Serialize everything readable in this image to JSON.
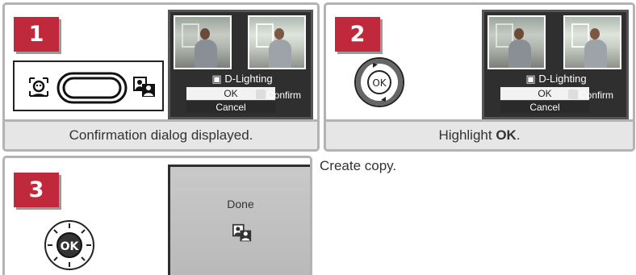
{
  "steps": [
    {
      "number": "1",
      "caption": "Confirmation dialog displayed.",
      "screen": {
        "menu_title": "D-Lighting",
        "ok_label": "OK",
        "cancel_label": "Cancel",
        "confirm_label": "Confirm"
      }
    },
    {
      "number": "2",
      "caption_prefix": "Highlight ",
      "caption_bold": "OK",
      "caption_suffix": ".",
      "dial_label": "OK",
      "screen": {
        "menu_title": "D-Lighting",
        "ok_label": "OK",
        "cancel_label": "Cancel",
        "confirm_label": "Confirm"
      }
    },
    {
      "number": "3",
      "dial_label": "OK",
      "screen_text": "Done",
      "description": "Create copy."
    }
  ],
  "colors": {
    "step_badge": "#c0283c",
    "panel_border": "#b3b3b3",
    "caption_bg": "#e6e6e6"
  },
  "icons": [
    "face-priority-icon",
    "rocker-switch-icon",
    "copy-icon",
    "multi-selector-dial-icon"
  ]
}
